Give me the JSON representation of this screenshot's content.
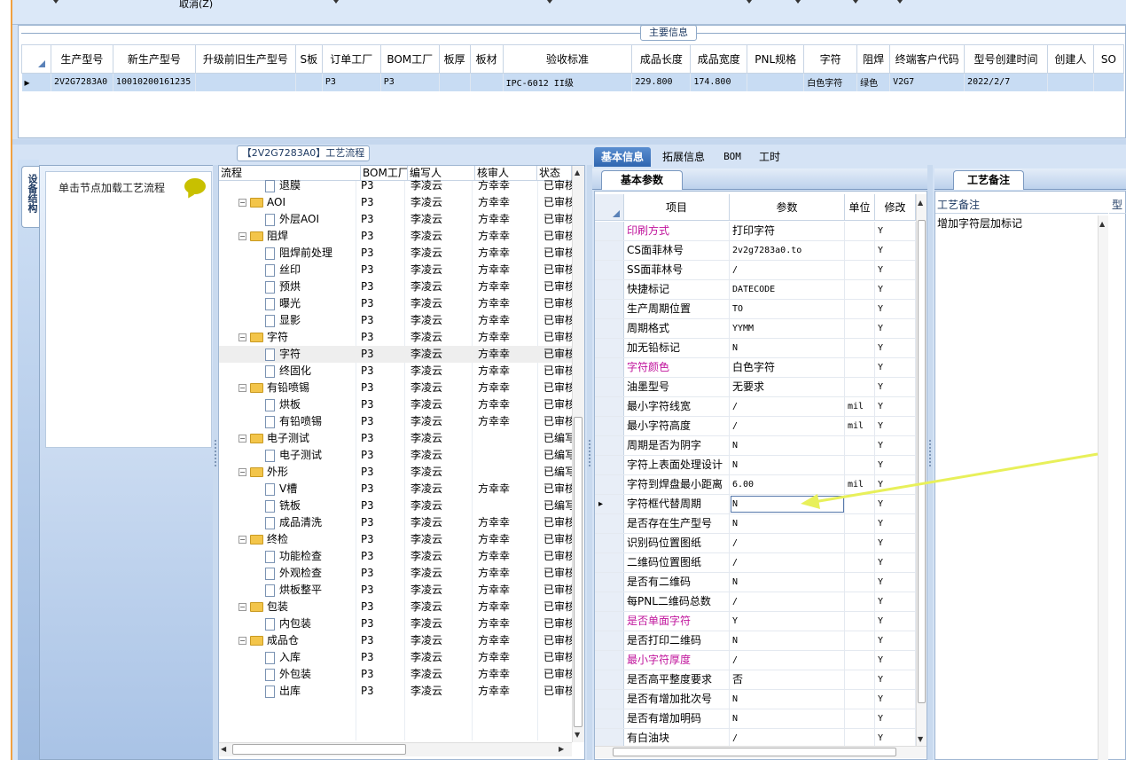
{
  "toolbar": {
    "cancel_label": "取消(Z)"
  },
  "main_info": {
    "title": "主要信息",
    "columns": [
      "生产型号",
      "新生产型号",
      "升级前旧生产型号",
      "S板",
      "订单工厂",
      "BOM工厂",
      "板厚",
      "板材",
      "验收标准",
      "成品长度",
      "成品宽度",
      "PNL规格",
      "字符",
      "阻焊",
      "终端客户代码",
      "型号创建时间",
      "创建人",
      "SO"
    ],
    "row": [
      "2V2G7283A0",
      "10010200161235",
      "",
      "",
      "P3",
      "P3",
      "",
      "",
      "IPC-6012 II级",
      "229.800",
      "174.800",
      "",
      "白色字符",
      "绿色",
      "V2G7",
      "2022/2/7",
      "",
      ""
    ]
  },
  "left_panel": {
    "vertical_tab": "设备结构",
    "hint": "单击节点加载工艺流程"
  },
  "flow": {
    "title": "【2V2G7283A0】工艺流程",
    "columns": [
      "流程",
      "BOM工厂",
      "编写人",
      "核审人",
      "状态"
    ],
    "rows": [
      {
        "level": 1,
        "type": "doc",
        "name": "退膜",
        "bom": "P3",
        "author": "李凌云",
        "reviewer": "方幸幸",
        "status": "已审核"
      },
      {
        "level": 0,
        "type": "folder",
        "name": "AOI",
        "bom": "P3",
        "author": "李凌云",
        "reviewer": "方幸幸",
        "status": "已审核"
      },
      {
        "level": 1,
        "type": "doc",
        "name": "外层AOI",
        "bom": "P3",
        "author": "李凌云",
        "reviewer": "方幸幸",
        "status": "已审核"
      },
      {
        "level": 0,
        "type": "folder",
        "name": "阻焊",
        "bom": "P3",
        "author": "李凌云",
        "reviewer": "方幸幸",
        "status": "已审核"
      },
      {
        "level": 1,
        "type": "doc",
        "name": "阻焊前处理",
        "bom": "P3",
        "author": "李凌云",
        "reviewer": "方幸幸",
        "status": "已审核"
      },
      {
        "level": 1,
        "type": "doc",
        "name": "丝印",
        "bom": "P3",
        "author": "李凌云",
        "reviewer": "方幸幸",
        "status": "已审核"
      },
      {
        "level": 1,
        "type": "doc",
        "name": "预烘",
        "bom": "P3",
        "author": "李凌云",
        "reviewer": "方幸幸",
        "status": "已审核"
      },
      {
        "level": 1,
        "type": "doc",
        "name": "曝光",
        "bom": "P3",
        "author": "李凌云",
        "reviewer": "方幸幸",
        "status": "已审核"
      },
      {
        "level": 1,
        "type": "doc",
        "name": "显影",
        "bom": "P3",
        "author": "李凌云",
        "reviewer": "方幸幸",
        "status": "已审核"
      },
      {
        "level": 0,
        "type": "folder",
        "name": "字符",
        "bom": "P3",
        "author": "李凌云",
        "reviewer": "方幸幸",
        "status": "已审核"
      },
      {
        "level": 1,
        "type": "doc",
        "name": "字符",
        "bom": "P3",
        "author": "李凌云",
        "reviewer": "方幸幸",
        "status": "已审核",
        "selected": true
      },
      {
        "level": 1,
        "type": "doc",
        "name": "终固化",
        "bom": "P3",
        "author": "李凌云",
        "reviewer": "方幸幸",
        "status": "已审核"
      },
      {
        "level": 0,
        "type": "folder",
        "name": "有铅喷锡",
        "bom": "P3",
        "author": "李凌云",
        "reviewer": "方幸幸",
        "status": "已审核"
      },
      {
        "level": 1,
        "type": "doc",
        "name": "烘板",
        "bom": "P3",
        "author": "李凌云",
        "reviewer": "方幸幸",
        "status": "已审核"
      },
      {
        "level": 1,
        "type": "doc",
        "name": "有铅喷锡",
        "bom": "P3",
        "author": "李凌云",
        "reviewer": "方幸幸",
        "status": "已审核"
      },
      {
        "level": 0,
        "type": "folder",
        "name": "电子测试",
        "bom": "P3",
        "author": "李凌云",
        "reviewer": "",
        "status": "已编写"
      },
      {
        "level": 1,
        "type": "doc",
        "name": "电子测试",
        "bom": "P3",
        "author": "李凌云",
        "reviewer": "",
        "status": "已编写"
      },
      {
        "level": 0,
        "type": "folder",
        "name": "外形",
        "bom": "P3",
        "author": "李凌云",
        "reviewer": "",
        "status": "已编写"
      },
      {
        "level": 1,
        "type": "doc",
        "name": "V槽",
        "bom": "P3",
        "author": "李凌云",
        "reviewer": "方幸幸",
        "status": "已审核"
      },
      {
        "level": 1,
        "type": "doc",
        "name": "铣板",
        "bom": "P3",
        "author": "李凌云",
        "reviewer": "",
        "status": "已编写"
      },
      {
        "level": 1,
        "type": "doc",
        "name": "成品清洗",
        "bom": "P3",
        "author": "李凌云",
        "reviewer": "方幸幸",
        "status": "已审核"
      },
      {
        "level": 0,
        "type": "folder",
        "name": "终检",
        "bom": "P3",
        "author": "李凌云",
        "reviewer": "方幸幸",
        "status": "已审核"
      },
      {
        "level": 1,
        "type": "doc",
        "name": "功能检查",
        "bom": "P3",
        "author": "李凌云",
        "reviewer": "方幸幸",
        "status": "已审核"
      },
      {
        "level": 1,
        "type": "doc",
        "name": "外观检查",
        "bom": "P3",
        "author": "李凌云",
        "reviewer": "方幸幸",
        "status": "已审核"
      },
      {
        "level": 1,
        "type": "doc",
        "name": "烘板整平",
        "bom": "P3",
        "author": "李凌云",
        "reviewer": "方幸幸",
        "status": "已审核"
      },
      {
        "level": 0,
        "type": "folder",
        "name": "包装",
        "bom": "P3",
        "author": "李凌云",
        "reviewer": "方幸幸",
        "status": "已审核"
      },
      {
        "level": 1,
        "type": "doc",
        "name": "内包装",
        "bom": "P3",
        "author": "李凌云",
        "reviewer": "方幸幸",
        "status": "已审核"
      },
      {
        "level": 0,
        "type": "folder",
        "name": "成品仓",
        "bom": "P3",
        "author": "李凌云",
        "reviewer": "方幸幸",
        "status": "已审核"
      },
      {
        "level": 1,
        "type": "doc",
        "name": "入库",
        "bom": "P3",
        "author": "李凌云",
        "reviewer": "方幸幸",
        "status": "已审核"
      },
      {
        "level": 1,
        "type": "doc",
        "name": "外包装",
        "bom": "P3",
        "author": "李凌云",
        "reviewer": "方幸幸",
        "status": "已审核"
      },
      {
        "level": 1,
        "type": "doc",
        "name": "出库",
        "bom": "P3",
        "author": "李凌云",
        "reviewer": "方幸幸",
        "status": "已审核"
      }
    ]
  },
  "tabs": [
    "基本信息",
    "拓展信息",
    "BOM",
    "工时"
  ],
  "basic_params": {
    "subtab": "基本参数",
    "columns": [
      "项目",
      "参数",
      "单位",
      "修改"
    ],
    "rows": [
      {
        "item": "印刷方式",
        "value": "打印字符",
        "unit": "",
        "mod": "Y",
        "pink": true
      },
      {
        "item": "CS面菲林号",
        "value": "2v2g7283a0.to",
        "unit": "",
        "mod": "Y"
      },
      {
        "item": "SS面菲林号",
        "value": "/",
        "unit": "",
        "mod": "Y"
      },
      {
        "item": "快捷标记",
        "value": "DATECODE",
        "unit": "",
        "mod": "Y"
      },
      {
        "item": "生产周期位置",
        "value": "TO",
        "unit": "",
        "mod": "Y"
      },
      {
        "item": "周期格式",
        "value": "YYMM",
        "unit": "",
        "mod": "Y"
      },
      {
        "item": "加无铅标记",
        "value": "N",
        "unit": "",
        "mod": "Y"
      },
      {
        "item": "字符颜色",
        "value": "白色字符",
        "unit": "",
        "mod": "Y",
        "pink": true
      },
      {
        "item": "油墨型号",
        "value": "无要求",
        "unit": "",
        "mod": "Y"
      },
      {
        "item": "最小字符线宽",
        "value": "/",
        "unit": "mil",
        "mod": "Y"
      },
      {
        "item": "最小字符高度",
        "value": "/",
        "unit": "mil",
        "mod": "Y"
      },
      {
        "item": "周期是否为阴字",
        "value": "N",
        "unit": "",
        "mod": "Y"
      },
      {
        "item": "字符上表面处理设计",
        "value": "N",
        "unit": "",
        "mod": "Y"
      },
      {
        "item": "字符到焊盘最小距离",
        "value": "6.00",
        "unit": "mil",
        "mod": "Y"
      },
      {
        "item": "字符框代替周期",
        "value": "N",
        "unit": "",
        "mod": "Y",
        "current": true
      },
      {
        "item": "是否存在生产型号",
        "value": "N",
        "unit": "",
        "mod": "Y"
      },
      {
        "item": "识别码位置图纸",
        "value": "/",
        "unit": "",
        "mod": "Y"
      },
      {
        "item": "二维码位置图纸",
        "value": "/",
        "unit": "",
        "mod": "Y"
      },
      {
        "item": "是否有二维码",
        "value": "N",
        "unit": "",
        "mod": "Y"
      },
      {
        "item": "每PNL二维码总数",
        "value": "/",
        "unit": "",
        "mod": "Y"
      },
      {
        "item": "是否单面字符",
        "value": "Y",
        "unit": "",
        "mod": "Y",
        "pink": true
      },
      {
        "item": "是否打印二维码",
        "value": "N",
        "unit": "",
        "mod": "Y"
      },
      {
        "item": "最小字符厚度",
        "value": "/",
        "unit": "",
        "mod": "Y",
        "pink": true
      },
      {
        "item": "是否高平整度要求",
        "value": "否",
        "unit": "",
        "mod": "Y"
      },
      {
        "item": "是否有增加批次号",
        "value": "N",
        "unit": "",
        "mod": "Y"
      },
      {
        "item": "是否有增加明码",
        "value": "N",
        "unit": "",
        "mod": "Y"
      },
      {
        "item": "有白油块",
        "value": "/",
        "unit": "",
        "mod": "Y"
      }
    ]
  },
  "remarks": {
    "tab": "工艺备注",
    "header": "工艺备注",
    "header2": "型号",
    "text": "增加字符层加标记"
  },
  "colors": {
    "annotation_arrow": "#e8f05a",
    "pink_label": "#c0149c",
    "tab_active": "#3a72bf"
  }
}
